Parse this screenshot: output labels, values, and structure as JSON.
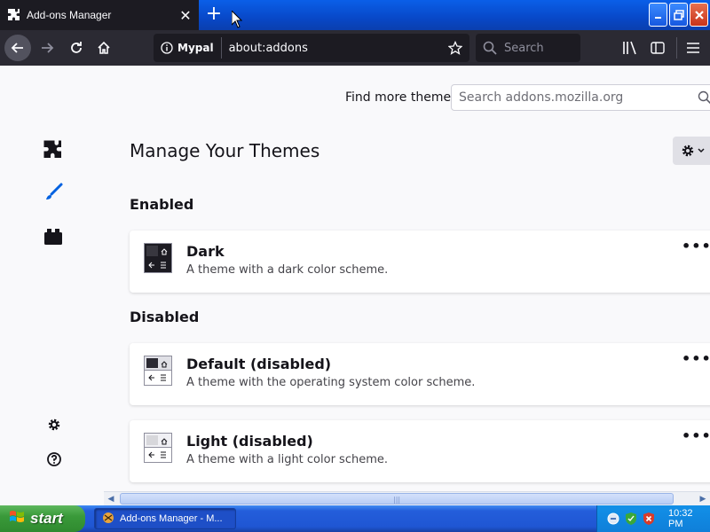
{
  "tab": {
    "title": "Add-ons Manager",
    "close": "✕",
    "new": "+"
  },
  "navbar": {
    "identity_label": "Mypal",
    "url": "about:addons",
    "search_placeholder": "Search"
  },
  "content": {
    "find_more_label": "Find more themes",
    "amo_search_placeholder": "Search addons.mozilla.org",
    "page_title": "Manage Your Themes",
    "sections": {
      "enabled": "Enabled",
      "disabled": "Disabled"
    },
    "themes": [
      {
        "name": "Dark",
        "description": "A theme with a dark color scheme.",
        "more": "•••"
      },
      {
        "name": "Default (disabled)",
        "description": "A theme with the operating system color scheme.",
        "more": "•••"
      },
      {
        "name": "Light (disabled)",
        "description": "A theme with a light color scheme.",
        "more": "•••"
      }
    ]
  },
  "taskbar": {
    "start_label": "start",
    "task_label": "Add-ons Manager - M...",
    "clock": "10:32 PM"
  },
  "colors": {
    "accent": "#0061e0",
    "toolbar": "#2b2a33",
    "content_bg": "#f9f9fb"
  }
}
